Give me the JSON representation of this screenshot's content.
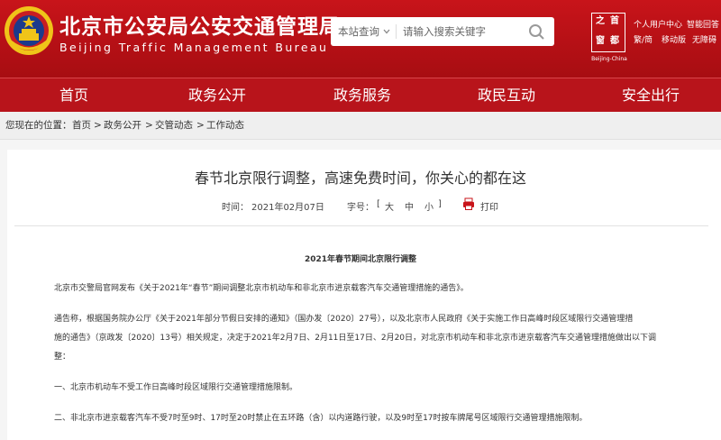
{
  "header": {
    "title": "北京市公安局公安交通管理局",
    "subtitle": "Beijing Traffic Management Bureau",
    "search": {
      "scope": "本站查询",
      "placeholder": "请输入搜索关键字"
    },
    "logo": {
      "chars": [
        "之",
        "首",
        "窗",
        "都"
      ],
      "caption": "Beijing-China"
    },
    "top_links": {
      "user_center": "个人用户中心",
      "smart_search": "智能回答",
      "simplified_traditional": "繁/简",
      "mobile": "移动版",
      "accessibility": "无障碍"
    }
  },
  "nav": {
    "items": [
      "首页",
      "政务公开",
      "政务服务",
      "政民互动",
      "安全出行"
    ]
  },
  "breadcrumb": {
    "prefix": "您现在的位置：",
    "items": [
      "首页",
      "政务公开",
      "交管动态",
      "工作动态"
    ],
    "separator": ">"
  },
  "article": {
    "title": "春节北京限行调整，高速免费时间，你关心的都在这",
    "time_label": "时间：",
    "date": "2021年02月07日",
    "font_label": "字号：",
    "bracket_open": "[",
    "sizes": [
      "大",
      "中",
      "小"
    ],
    "bracket_close": "]",
    "print_label": "打印",
    "subheading": "2021年春节期间北京限行调整",
    "paragraphs": [
      "北京市交警局官网发布《关于2021年“春节”期间调整北京市机动车和非北京市进京载客汽车交通管理措施的通告》。",
      "通告称，根据国务院办公厅《关于2021年部分节假日安排的通知》（国办发〔2020〕27号），以及北京市人民政府《关于实施工作日高峰时段区域限行交通管理措",
      "施的通告》（京政发〔2020〕13号）相关规定，决定于2021年2月7日、2月11日至17日、2月20日，对北京市机动车和非北京市进京载客汽车交通管理措施做出以下调",
      "整：",
      "一、北京市机动车不受工作日高峰时段区域限行交通管理措施限制。",
      "二、非北京市进京载客汽车不受7时至9时、17时至20时禁止在五环路（含）以内道路行驶，以及9时至17时按车牌尾号区域限行交通管理措施限制。"
    ]
  },
  "colors": {
    "header_red": "#c8141a",
    "nav_red": "#b8141b",
    "emblem_gold": "#f0c419"
  }
}
